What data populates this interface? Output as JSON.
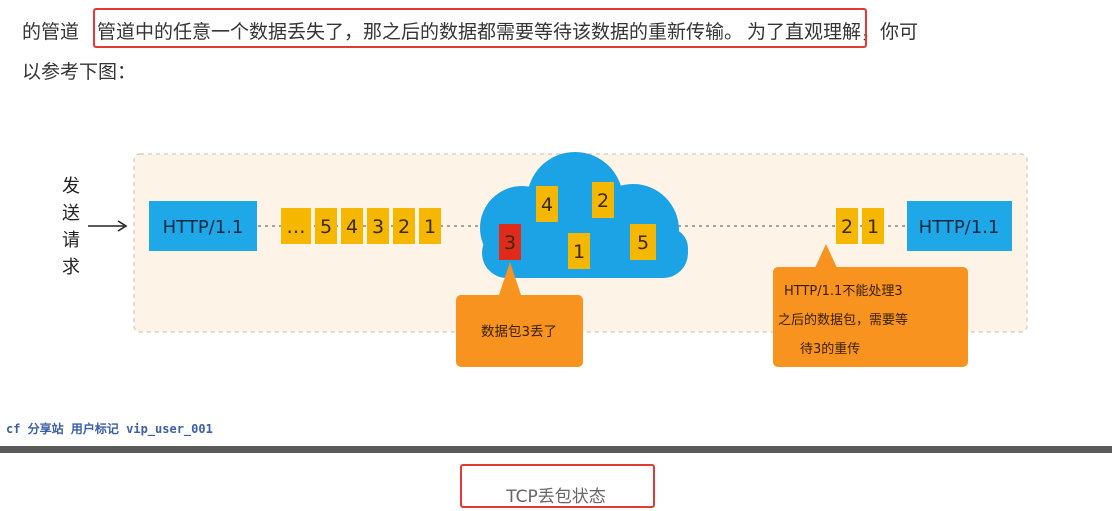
{
  "article": {
    "line1_prefix": "的管道",
    "line1_highlight": "管道中的任意一个数据丢失了，那之后的数据都需要等待该数据的重新传输。",
    "line1_suffix": "为了直观理解，你可",
    "line2": "以参考下图："
  },
  "diagram": {
    "side_label_chars": [
      "发",
      "送",
      "请",
      "求"
    ],
    "left_block_label": "HTTP/1.1",
    "queue_packets": [
      "…",
      "5",
      "4",
      "3",
      "2",
      "1"
    ],
    "cloud_packets": [
      {
        "label": "4",
        "lost": false
      },
      {
        "label": "2",
        "lost": false
      },
      {
        "label": "3",
        "lost": true
      },
      {
        "label": "1",
        "lost": false
      },
      {
        "label": "5",
        "lost": false
      }
    ],
    "received_packets": [
      "2",
      "1"
    ],
    "right_block_label": "HTTP/1.1",
    "callout_lost": "数据包3丢了",
    "callout_wait_lines": [
      "HTTP/1.1不能处理3",
      "之后的数据包，需要等",
      "待3的重传"
    ],
    "colors": {
      "http_block": "#1ea8e8",
      "packet": "#f5b700",
      "lost_packet": "#e02a1a",
      "cloud": "#1ba3e6",
      "callout": "#f7931e",
      "panel_bg": "#fdf3e6"
    }
  },
  "watermark": "cf 分享站 用户标记 vip_user_001",
  "caption": "TCP丢包状态"
}
